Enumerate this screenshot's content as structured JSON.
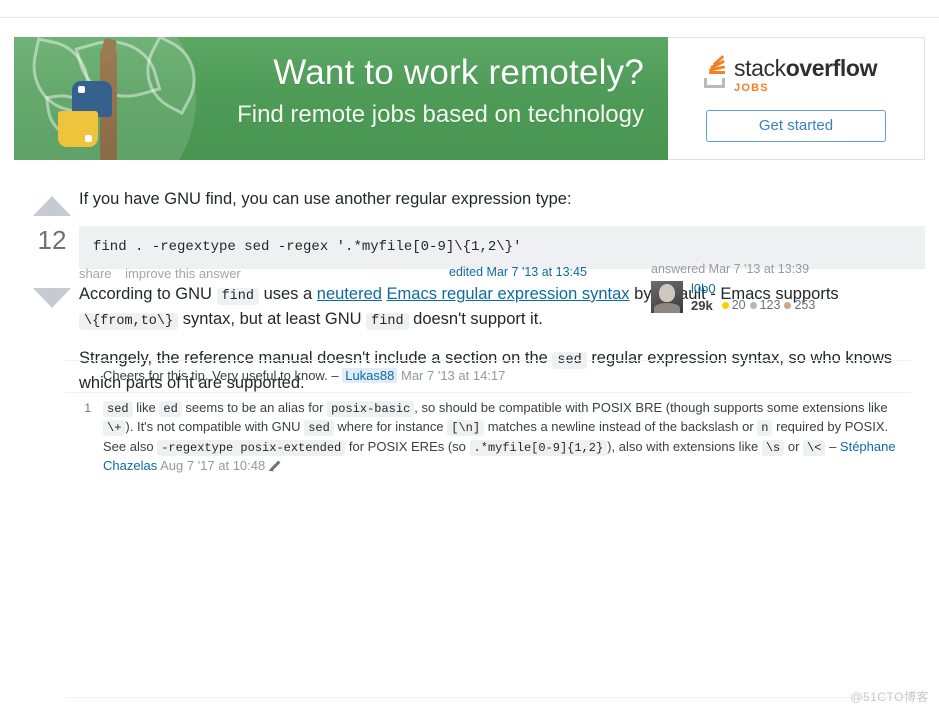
{
  "ad": {
    "headline": "Want to work remotely?",
    "subline": "Find remote jobs based on technology",
    "logo_stack": "stack",
    "logo_overflow": "overflow",
    "logo_jobs": "JOBS",
    "cta_label": "Get started"
  },
  "answer": {
    "vote_count": "12",
    "paragraph_1": "If you have GNU find, you can use another regular expression type:",
    "code_block": "find . -regextype sed -regex '.*myfile[0-9]\\{1,2\\}'",
    "p2_before": "According to GNU",
    "p2_code_find": "find",
    "p2_mid": "uses a",
    "p2_link_1": "neutered",
    "p2_link_2": "Emacs regular expression syntax",
    "p2_after_link": "by default - Emacs supports",
    "p2_code_fromto": "\\{from,to\\}",
    "p2_tail": "syntax, but at least GNU",
    "p2_code_find2": "find",
    "p2_end": "doesn't support it.",
    "p3_before": "Strangely, the reference manual doesn't include a section on the",
    "p3_code_sed": "sed",
    "p3_after": "regular expression syntax, so who knows which parts of it are supported.",
    "share_label": "share",
    "improve_label": "improve this answer",
    "edited_label": "edited Mar 7 '13 at 13:45",
    "answered_label": "answered Mar 7 '13 at 13:39",
    "user_name": "l0b0",
    "user_rep": "29k",
    "badge_gold": "20",
    "badge_silver": "123",
    "badge_bronze": "253"
  },
  "comments": [
    {
      "score": "",
      "text": "Cheers for this tip. Very useful to know.",
      "dash": "–",
      "user": "Lukas88",
      "date": "Mar 7 '13 at 14:17",
      "user_highlight": true
    },
    {
      "score": "1",
      "c1": "sed",
      "t1": "like",
      "c2": "ed",
      "t2": "seems to be an alias for",
      "c3": "posix-basic",
      "t3": ", so should be compatible with POSIX BRE (though supports some extensions like",
      "c4": "\\+",
      "t4": "). It's not compatible with GNU",
      "c5": "sed",
      "t5": "where for instance",
      "c6": "[\\n]",
      "t6": "matches a newline instead of the backslash or",
      "c7": "n",
      "t7": "required by POSIX. See also",
      "c8": "-regextype posix-extended",
      "t8": "for POSIX EREs (so",
      "c9": ".*myfile[0-9]{1,2}",
      "t9": "), also with extensions like",
      "c10": "\\s",
      "t10": "or",
      "c11": "\\<",
      "dash": "–",
      "user": "Stéphane Chazelas",
      "date": "Aug 7 '17 at 10:48",
      "user_highlight": false
    }
  ],
  "watermark": "@51CTO博客"
}
